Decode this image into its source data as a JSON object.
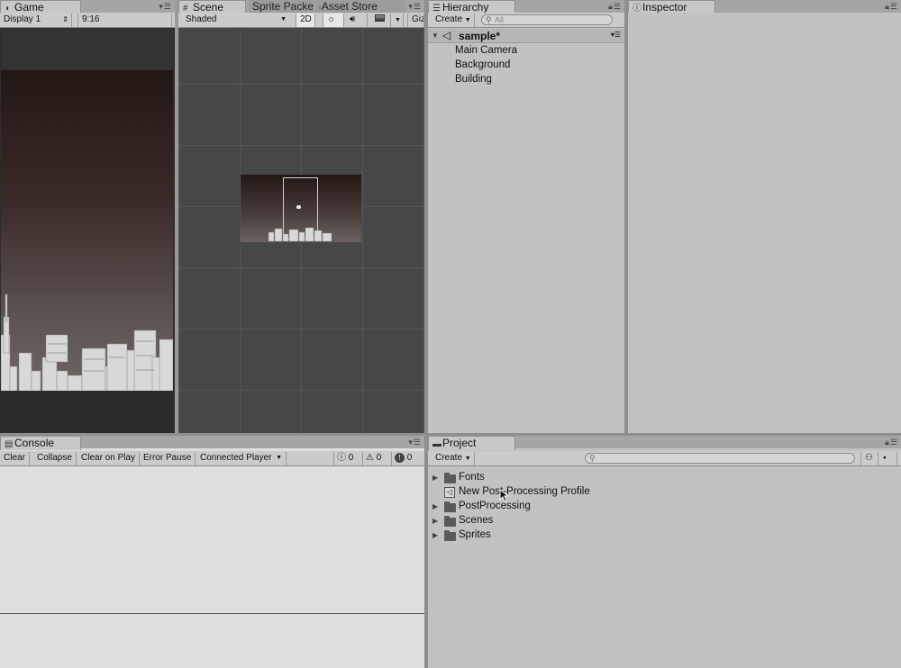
{
  "game": {
    "tab_label": "Game",
    "display_value": "Display 1",
    "aspect_value": "9:16"
  },
  "scene": {
    "tab_label": "Scene",
    "tab_sprite_packer": "Sprite Packer",
    "tab_asset_store": "Asset Store",
    "shading_value": "Shaded",
    "mode_2d": "2D",
    "gizmos_label": "Giz"
  },
  "hierarchy": {
    "tab_label": "Hierarchy",
    "create_label": "Create",
    "search_placeholder": "All",
    "scene_name": "sample*",
    "items": [
      {
        "label": "Main Camera"
      },
      {
        "label": "Background"
      },
      {
        "label": "Building"
      }
    ]
  },
  "inspector": {
    "tab_label": "Inspector"
  },
  "console": {
    "tab_label": "Console",
    "clear_label": "Clear",
    "collapse_label": "Collapse",
    "clear_on_play_label": "Clear on Play",
    "error_pause_label": "Error Pause",
    "connected_player_label": "Connected Player",
    "info_count": "0",
    "warning_count": "0",
    "error_count": "0"
  },
  "project": {
    "tab_label": "Project",
    "create_label": "Create",
    "items": [
      {
        "label": "Fonts",
        "type": "folder"
      },
      {
        "label": "New Post-Processing Profile",
        "type": "asset"
      },
      {
        "label": "PostProcessing",
        "type": "folder"
      },
      {
        "label": "Scenes",
        "type": "folder"
      },
      {
        "label": "Sprites",
        "type": "folder"
      }
    ]
  },
  "colors": {
    "panel_bg": "#c2c2c2",
    "tab_bg": "#a5a5a5",
    "viewport_bg": "#474747",
    "sky_top": "#231714",
    "sky_bottom": "#6e6663"
  }
}
